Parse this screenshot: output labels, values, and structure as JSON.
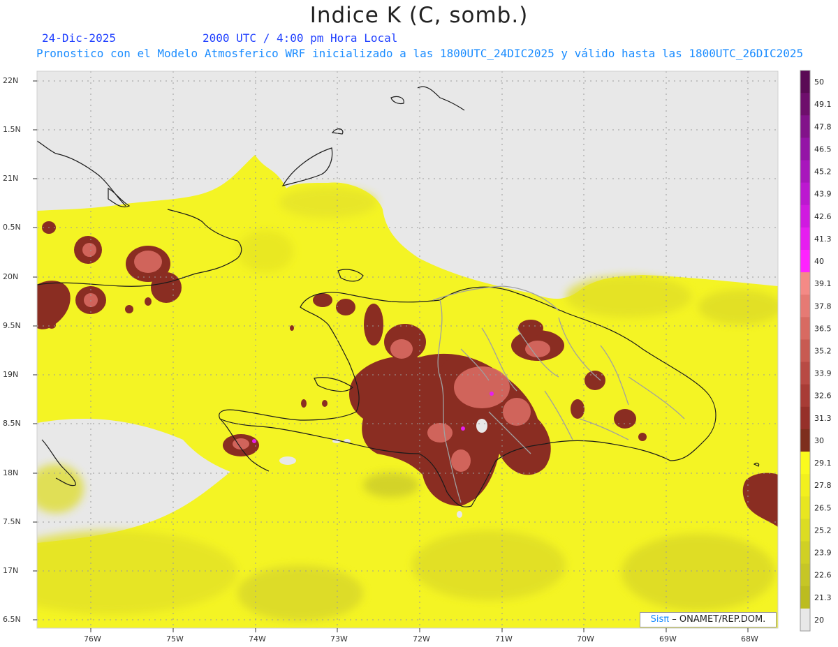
{
  "header": {
    "title": "Indice K (C, somb.)",
    "date": "24-Dic-2025",
    "time": "2000 UTC / 4:00 pm Hora Local",
    "description": "Pronostico con el Modelo Atmosferico WRF inicializado a las 1800UTC_24DIC2025 y válido hasta las  1800UTC_26DIC2025"
  },
  "axes": {
    "lat_labels": [
      "22N",
      "1.5N",
      "21N",
      "0.5N",
      "20N",
      "9.5N",
      "19N",
      "8.5N",
      "18N",
      "7.5N",
      "17N",
      "6.5N"
    ],
    "lon_labels": [
      "76W",
      "75W",
      "74W",
      "73W",
      "72W",
      "71W",
      "70W",
      "69W",
      "68W"
    ]
  },
  "colorbar": {
    "labels": [
      "50",
      "49.1",
      "47.8",
      "46.5",
      "45.2",
      "43.9",
      "42.6",
      "41.3",
      "40",
      "39.1",
      "37.8",
      "36.5",
      "35.2",
      "33.9",
      "32.6",
      "31.3",
      "30",
      "29.1",
      "27.8",
      "26.5",
      "25.2",
      "23.9",
      "22.6",
      "21.3",
      "20"
    ],
    "colors": [
      "#5a0a55",
      "#6e0e6c",
      "#82128a",
      "#9414a6",
      "#a816bc",
      "#bc18d0",
      "#d01ae0",
      "#e61ef0",
      "#ff22ff",
      "#f48a86",
      "#e67a74",
      "#d86a62",
      "#c85a52",
      "#b84a44",
      "#a83c36",
      "#96302a",
      "#7e2e1e",
      "#fafa1e",
      "#f2f01e",
      "#e8e620",
      "#dcdc22",
      "#d0d024",
      "#c6c626",
      "#bcbc20",
      "#e8e8e8"
    ]
  },
  "credit": {
    "brand": "Sisπ",
    "text": "– ONAMET/REP.DOM."
  }
}
